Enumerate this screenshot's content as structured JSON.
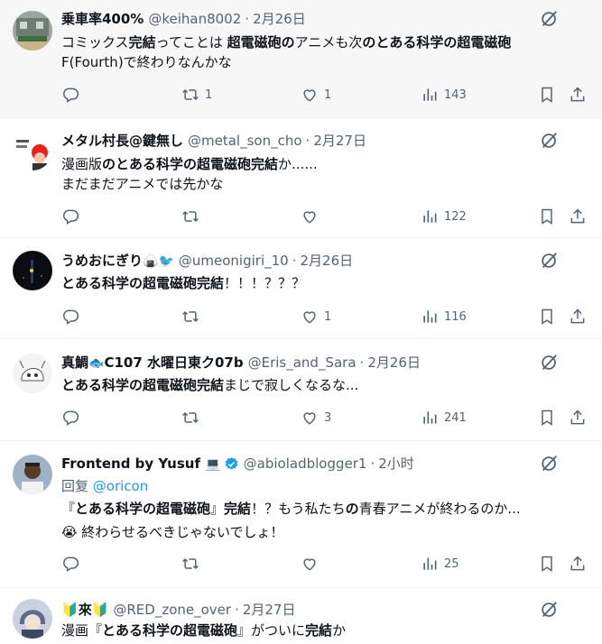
{
  "tweets": [
    {
      "name_pre": "乗車率400%",
      "name_emoji": "",
      "name_post": "",
      "verified": false,
      "handle": "@keihan8002",
      "date": "2月26日",
      "reply_to": "",
      "lines": [
        [
          {
            "t": "コミックス",
            "b": false
          },
          {
            "t": "完結",
            "b": true
          },
          {
            "t": "ってことは ",
            "b": false
          },
          {
            "t": "超電磁砲の",
            "b": true
          },
          {
            "t": "アニメも次",
            "b": false
          },
          {
            "t": "のとある科学の超電磁砲",
            "b": true
          }
        ],
        [
          {
            "t": "F(Fourth)で終わりなんかな",
            "b": false
          }
        ]
      ],
      "replies": "",
      "retweets": "1",
      "likes": "1",
      "views": "143"
    },
    {
      "name_pre": "メタル村長@鍵無し",
      "name_emoji": "",
      "name_post": "",
      "verified": false,
      "handle": "@metal_son_cho",
      "date": "2月27日",
      "reply_to": "",
      "lines": [
        [
          {
            "t": "漫画版",
            "b": false
          },
          {
            "t": "のとある科学の超電磁砲完結",
            "b": true
          },
          {
            "t": "か......",
            "b": false
          }
        ],
        [
          {
            "t": "まだまだアニメでは先かな",
            "b": false
          }
        ]
      ],
      "replies": "",
      "retweets": "",
      "likes": "",
      "views": "122"
    },
    {
      "name_pre": "うめおにぎり",
      "name_emoji": "🍙🐦",
      "name_post": "",
      "verified": false,
      "handle": "@umeonigiri_10",
      "date": "2月26日",
      "reply_to": "",
      "lines": [
        [
          {
            "t": "とある科学の超電磁砲完結",
            "b": true
          },
          {
            "t": "！！！？？？",
            "b": false
          }
        ]
      ],
      "replies": "",
      "retweets": "",
      "likes": "1",
      "views": "116"
    },
    {
      "name_pre": "真鯛",
      "name_emoji": "🐟",
      "name_post": "C107 水曜日東ク07b",
      "verified": false,
      "handle": "@Eris_and_Sara",
      "date": "2月26日",
      "reply_to": "",
      "lines": [
        [
          {
            "t": "とある科学の超電磁砲完結",
            "b": true
          },
          {
            "t": "まじで寂しくなるな...",
            "b": false
          }
        ]
      ],
      "replies": "",
      "retweets": "",
      "likes": "3",
      "views": "241"
    },
    {
      "name_pre": "Frontend by Yusuf",
      "name_emoji": "💻",
      "name_post": "",
      "verified": true,
      "handle": "@abioladblogger1",
      "date": "2小时",
      "reply_label": "回复",
      "reply_to": "@oricon",
      "lines": [
        [
          {
            "t": "『",
            "b": false
          },
          {
            "t": "とある科学の超電磁砲",
            "b": true
          },
          {
            "t": "』",
            "b": false
          },
          {
            "t": "完結",
            "b": true
          },
          {
            "t": "！？もう私たち",
            "b": false
          },
          {
            "t": "の",
            "b": true
          },
          {
            "t": "青春アニメが終わるのか...",
            "b": false
          }
        ],
        [
          {
            "t": "😭 終わらせるべきじゃないでしょ！",
            "b": false
          }
        ]
      ],
      "replies": "",
      "retweets": "",
      "likes": "",
      "views": "25"
    },
    {
      "name_pre": "🔰",
      "name_emoji": "",
      "name_post": "來🔰",
      "verified": false,
      "handle": "@RED_zone_over",
      "date": "2月27日",
      "reply_to": "",
      "lines": [
        [
          {
            "t": "漫画『",
            "b": false
          },
          {
            "t": "とある科学の超電磁砲",
            "b": true
          },
          {
            "t": "』がついに",
            "b": false
          },
          {
            "t": "完結",
            "b": true
          },
          {
            "t": "か",
            "b": false
          }
        ]
      ],
      "replies": "",
      "retweets": "",
      "likes": "",
      "views": ""
    }
  ],
  "colors": {
    "text": "#0f1419",
    "muted": "#536471",
    "link": "#1d9bf0",
    "highlight_bg": "#f7f7f7",
    "divider": "#eff3f4"
  },
  "icons": [
    "reply-icon",
    "retweet-icon",
    "like-icon",
    "views-icon",
    "bookmark-icon",
    "share-icon",
    "grok-icon",
    "verified-icon"
  ]
}
